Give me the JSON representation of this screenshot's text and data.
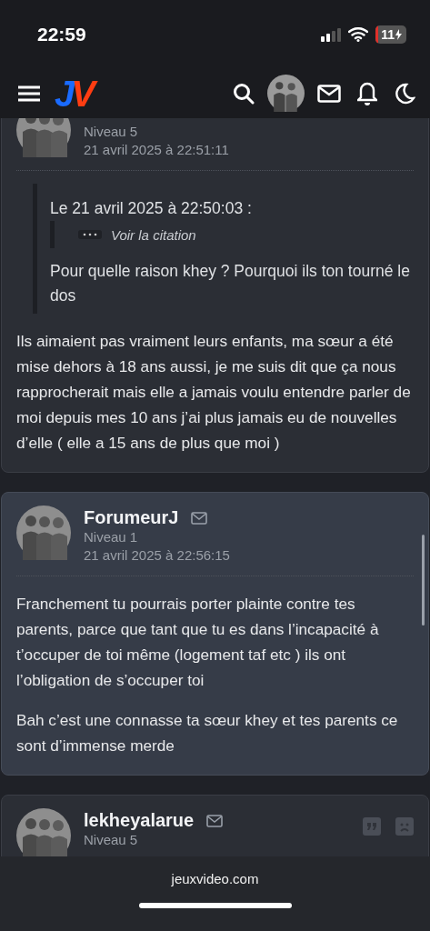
{
  "status_bar": {
    "time": "22:59",
    "battery": "11"
  },
  "header": {
    "logo": {
      "first": "J",
      "second": "V"
    }
  },
  "posts": [
    {
      "level": "Niveau 5",
      "date": "21 avril 2025 à 22:51:11",
      "highlighted": false,
      "actions": false,
      "quote": {
        "header": "Le 21 avril 2025 à 22:50:03 :",
        "link": "Voir la citation",
        "text": "Pour quelle raison khey ? Pourquoi ils ton tourné le dos"
      },
      "paragraphs": [
        "Ils aimaient pas vraiment leurs enfants, ma sœur a été mise dehors à 18 ans aussi, je me suis dit que ça nous rapprocherait mais elle a jamais voulu entendre parler de moi depuis mes 10 ans j’ai plus jamais eu de nouvelles d’elle ( elle a 15 ans de plus que moi )"
      ]
    },
    {
      "author": "ForumeurJ",
      "level": "Niveau 1",
      "date": "21 avril 2025 à 22:56:15",
      "highlighted": true,
      "actions": false,
      "paragraphs": [
        "Franchement tu pourrais porter plainte contre tes parents, parce que tant que tu es dans l’incapacité à t’occuper de toi même (logement taf etc ) ils ont l’obligation de s’occuper toi",
        "Bah c’est une connasse ta sœur khey et tes parents ce sont d’immense merde"
      ]
    },
    {
      "author": "lekheyalarue",
      "level": "Niveau 5",
      "highlighted": false,
      "actions": true
    }
  ],
  "bottom_bar": {
    "url": "jeuxvideo.com"
  }
}
